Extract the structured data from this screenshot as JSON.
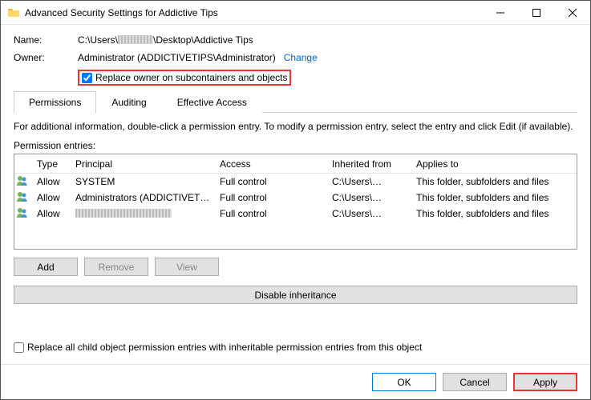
{
  "window": {
    "title": "Advanced Security Settings for Addictive Tips"
  },
  "nameField": {
    "label": "Name:",
    "prefix": "C:\\Users\\",
    "suffix": "\\Desktop\\Addictive Tips"
  },
  "ownerField": {
    "label": "Owner:",
    "value": "Administrator (ADDICTIVETIPS\\Administrator)",
    "changeLabel": "Change"
  },
  "replaceOwner": {
    "label": "Replace owner on subcontainers and objects",
    "checked": true
  },
  "tabs": {
    "permissions": "Permissions",
    "auditing": "Auditing",
    "effective": "Effective Access"
  },
  "infoText": "For additional information, double-click a permission entry. To modify a permission entry, select the entry and click Edit (if available).",
  "entriesLabel": "Permission entries:",
  "columns": {
    "type": "Type",
    "principal": "Principal",
    "access": "Access",
    "inherited": "Inherited from",
    "applies": "Applies to"
  },
  "entries": [
    {
      "type": "Allow",
      "principal": "SYSTEM",
      "principalBlur": false,
      "access": "Full control",
      "inheritedPrefix": "C:\\Users\\",
      "applies": "This folder, subfolders and files"
    },
    {
      "type": "Allow",
      "principal": "Administrators (ADDICTIVETIP...",
      "principalBlur": false,
      "access": "Full control",
      "inheritedPrefix": "C:\\Users\\",
      "applies": "This folder, subfolders and files"
    },
    {
      "type": "Allow",
      "principal": "",
      "principalBlur": true,
      "access": "Full control",
      "inheritedPrefix": "C:\\Users\\",
      "applies": "This folder, subfolders and files"
    }
  ],
  "buttons": {
    "add": "Add",
    "remove": "Remove",
    "view": "View",
    "disableInheritance": "Disable inheritance",
    "ok": "OK",
    "cancel": "Cancel",
    "apply": "Apply"
  },
  "replaceAll": {
    "label": "Replace all child object permission entries with inheritable permission entries from this object",
    "checked": false
  }
}
